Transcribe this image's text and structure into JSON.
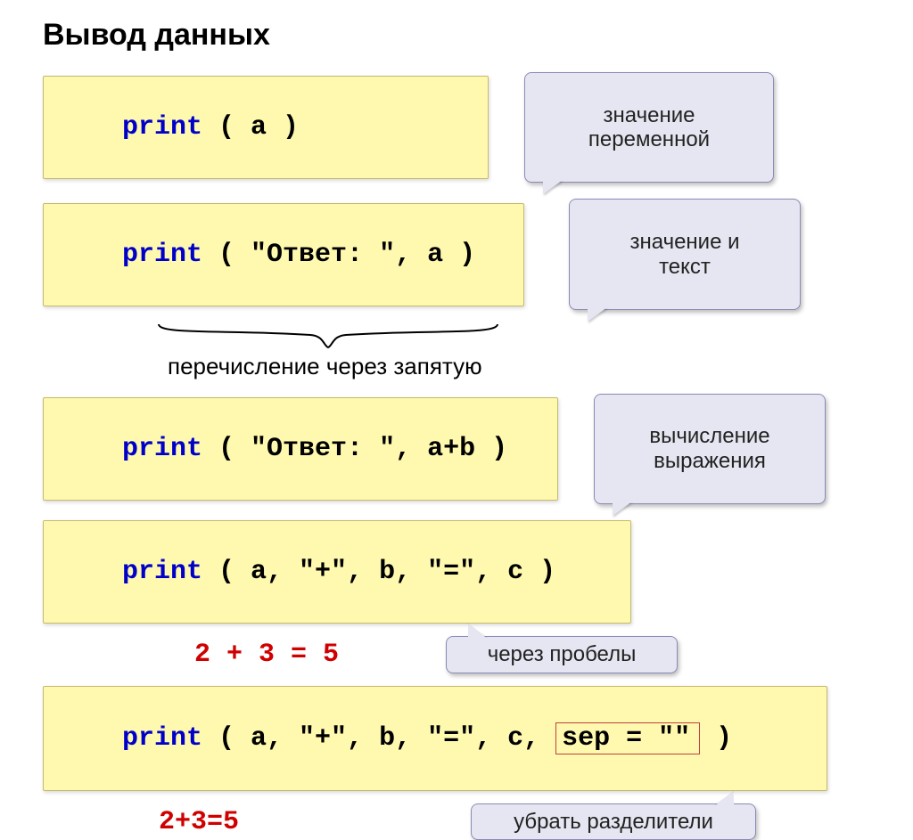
{
  "title": "Вывод данных",
  "callouts": {
    "var_value": "значение\nпеременной",
    "value_text": "значение и\nтекст",
    "calc_expr": "вычисление\nвыражения",
    "spaces": "через пробелы",
    "remove_sep": "убрать разделители"
  },
  "annot_enum": "перечисление через запятую",
  "code": {
    "line1_kw": "print",
    "line1_args": " ( a )",
    "line2_kw": "print",
    "line2_args": " ( \"Ответ: \", a )",
    "line3_kw": "print",
    "line3_args": " ( \"Ответ: \", a+b )",
    "line4_kw": "print",
    "line4_args": " ( a, \"+\", b, \"=\", c )",
    "line5_kw": "print",
    "line5_pre": " ( a, \"+\", b, \"=\", c, ",
    "line5_sep": "sep = \"\"",
    "line5_post": " )"
  },
  "outputs": {
    "out1": "2 + 3 = 5",
    "out2": "2+3=5"
  }
}
